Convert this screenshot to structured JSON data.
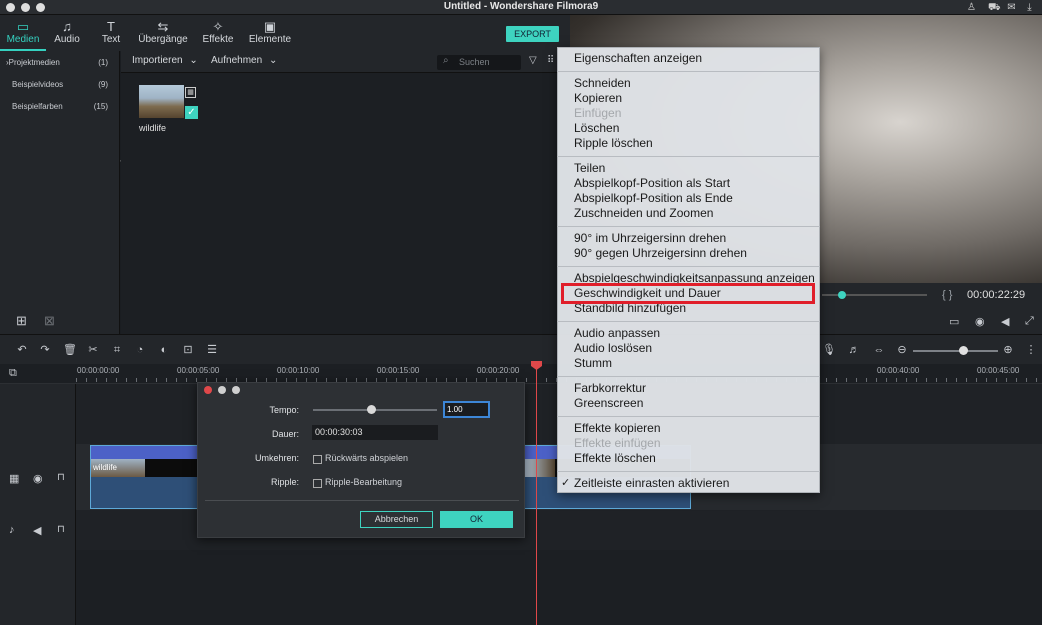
{
  "window": {
    "title": "Untitled - Wondershare Filmora9"
  },
  "tabs": [
    {
      "label": "Medien",
      "icon": "folder-icon"
    },
    {
      "label": "Audio",
      "icon": "music-note-icon"
    },
    {
      "label": "Text",
      "icon": "text-icon"
    },
    {
      "label": "Übergänge",
      "icon": "transition-icon"
    },
    {
      "label": "Effekte",
      "icon": "effects-icon"
    },
    {
      "label": "Elemente",
      "icon": "image-icon"
    }
  ],
  "export_label": "EXPORT",
  "sidebar": {
    "items": [
      {
        "label": "Projektmedien",
        "count": "(1)"
      },
      {
        "label": "Beispielvideos",
        "count": "(9)"
      },
      {
        "label": "Beispielfarben",
        "count": "(15)"
      }
    ]
  },
  "media": {
    "import_label": "Importieren",
    "record_label": "Aufnehmen",
    "search_placeholder": "Suchen",
    "clip_name": "wildlife"
  },
  "preview": {
    "timecode": "00:00:22:29",
    "brackets": "{ }"
  },
  "ruler": [
    "00:00:00:00",
    "00:00:05:00",
    "00:00:10:00",
    "00:00:15:00",
    "00:00:20:00",
    "00:00:40:00",
    "00:00:45:00"
  ],
  "timeline_clip_label": "wildlife",
  "dialog": {
    "tempo_label": "Tempo:",
    "tempo_value": "1.00",
    "tempo_level": 0.47,
    "dauer_label": "Dauer:",
    "dauer_value": "00:00:30:03",
    "umkehren_label": "Umkehren:",
    "reverse_option": "Rückwärts abspielen",
    "ripple_label": "Ripple:",
    "ripple_option": "Ripple-Bearbeitung",
    "cancel_label": "Abbrechen",
    "ok_label": "OK"
  },
  "context_menu": {
    "groups": [
      [
        {
          "label": "Eigenschaften anzeigen",
          "enabled": true
        }
      ],
      [
        {
          "label": "Schneiden",
          "enabled": true
        },
        {
          "label": "Kopieren",
          "enabled": true
        },
        {
          "label": "Einfügen",
          "enabled": false
        },
        {
          "label": "Löschen",
          "enabled": true
        },
        {
          "label": "Ripple löschen",
          "enabled": true
        }
      ],
      [
        {
          "label": "Teilen",
          "enabled": true
        },
        {
          "label": "Abspielkopf-Position als Start",
          "enabled": true
        },
        {
          "label": "Abspielkopf-Position als Ende",
          "enabled": true
        },
        {
          "label": "Zuschneiden und Zoomen",
          "enabled": true
        }
      ],
      [
        {
          "label": "90° im Uhrzeigersinn drehen",
          "enabled": true
        },
        {
          "label": "90° gegen Uhrzeigersinn drehen",
          "enabled": true
        }
      ],
      [
        {
          "label": "Abspielgeschwindigkeitsanpassung anzeigen",
          "enabled": true
        },
        {
          "label": "Geschwindigkeit und Dauer",
          "enabled": true,
          "highlighted": true
        },
        {
          "label": "Standbild hinzufügen",
          "enabled": true
        }
      ],
      [
        {
          "label": "Audio anpassen",
          "enabled": true
        },
        {
          "label": "Audio loslösen",
          "enabled": true
        },
        {
          "label": "Stumm",
          "enabled": true
        }
      ],
      [
        {
          "label": "Farbkorrektur",
          "enabled": true
        },
        {
          "label": "Greenscreen",
          "enabled": true
        }
      ],
      [
        {
          "label": "Effekte kopieren",
          "enabled": true
        },
        {
          "label": "Effekte einfügen",
          "enabled": false
        },
        {
          "label": "Effekte löschen",
          "enabled": true
        }
      ],
      [
        {
          "label": "Zeitleiste einrasten aktivieren",
          "enabled": true,
          "checked": true
        }
      ]
    ]
  },
  "colors": {
    "accent": "#3ed3c0",
    "highlight_border": "#e01e2a",
    "playhead": "#e0484a"
  }
}
